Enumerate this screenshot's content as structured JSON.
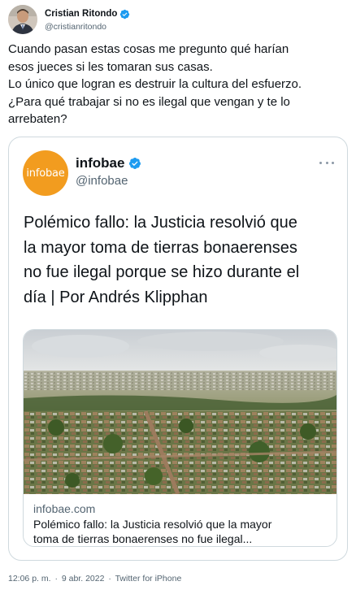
{
  "tweet": {
    "author": {
      "name": "Cristian Ritondo",
      "handle": "@cristianritondo",
      "verified": true
    },
    "text_lines": [
      "Cuando pasan estas cosas me pregunto qué harían",
      "esos jueces si les tomaran sus casas.",
      "Lo único que logran es destruir la cultura del esfuerzo.",
      "¿Para qué trabajar si no es ilegal que vengan y te lo",
      "arrebaten?"
    ],
    "time": "12:06 p. m.",
    "separator": "·",
    "date": "9 abr. 2022",
    "source": "Twitter for iPhone"
  },
  "quoted": {
    "author": {
      "name": "infobae",
      "handle": "@infobae",
      "avatar_logo_text": "infobae",
      "avatar_color": "#f29c1f",
      "verified": true
    },
    "more_icon": "more-horizontal-icon",
    "text_lines": [
      "Polémico fallo: la Justicia resolvió que",
      "la mayor toma de tierras bonaerenses",
      "no fue ilegal porque se hizo durante el",
      "día | Por Andrés Klipphan"
    ],
    "card": {
      "image_alt": "aerial-view-settlement",
      "domain": "infobae.com",
      "title_lines": [
        "Polémico fallo: la Justicia resolvió que la mayor",
        "toma de tierras bonaerenses no fue ilegal..."
      ]
    }
  },
  "colors": {
    "verified": "#1d9bf0",
    "secondary_text": "#536471",
    "border": "#cfd9de"
  }
}
